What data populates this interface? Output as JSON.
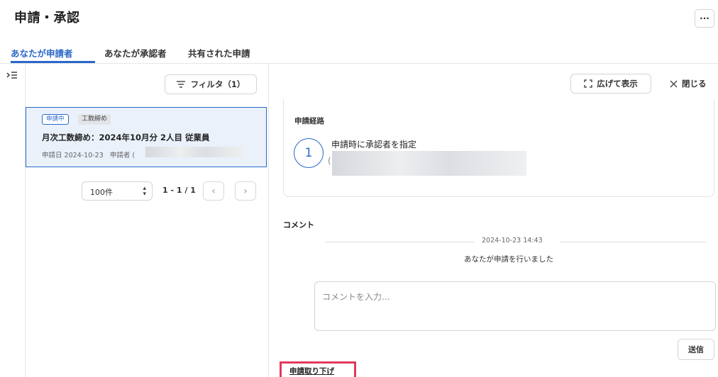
{
  "header": {
    "title": "申請・承認",
    "more_label": "···"
  },
  "tabs": [
    {
      "label": "あなたが申請者",
      "active": true
    },
    {
      "label": "あなたが承認者",
      "active": false
    },
    {
      "label": "共有された申請",
      "active": false
    }
  ],
  "list": {
    "filter_label": "フィルタ（1）",
    "items": [
      {
        "status": "申請中",
        "type": "工数締め",
        "title": "月次工数締め：2024年10月分 2人目 従業員",
        "date_label": "申請日",
        "date": "2024-10-23",
        "applicant_label": "申請者",
        "applicant_initial": "("
      }
    ],
    "page_size": "100件",
    "page_range": "1 - 1 / 1"
  },
  "detail": {
    "expand_label": "広げて表示",
    "close_label": "閉じる",
    "route": {
      "title": "申請経路",
      "steps": [
        {
          "number": "1",
          "label": "申請時に承認者を指定",
          "approver_initial": "("
        }
      ]
    },
    "comments": {
      "title": "コメント",
      "entries": [
        {
          "timestamp": "2024-10-23 14:43",
          "text": "あなたが申請を行いました"
        }
      ],
      "input_placeholder": "コメントを入力...",
      "send_label": "送信"
    },
    "withdraw_label": "申請取り下げ"
  },
  "colors": {
    "accent": "#2a67c9",
    "selected_bg": "#eaf1fb",
    "highlight": "#e03a5c"
  }
}
